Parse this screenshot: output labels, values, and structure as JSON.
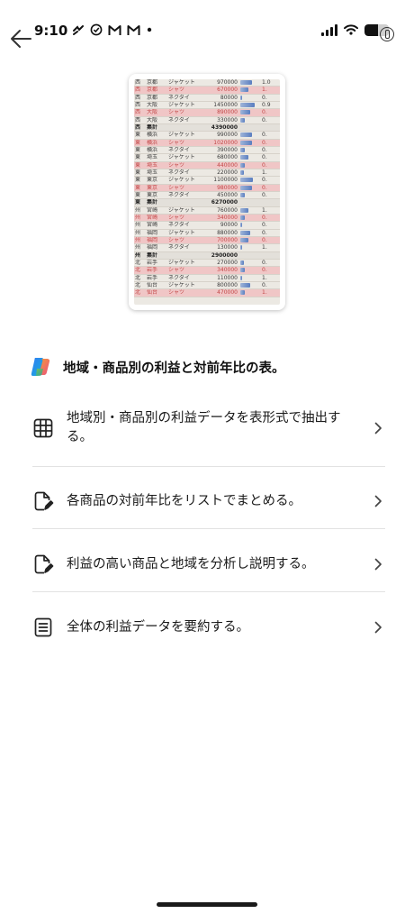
{
  "status": {
    "time": "9:10",
    "left_icons": [
      "missed-call-icon",
      "check-circle-icon",
      "gmail-icon",
      "gmail-icon",
      "dot-icon"
    ],
    "signal_bars": 4,
    "battery_level": 0.55
  },
  "thumbnail": {
    "rows": [
      {
        "c1": "西",
        "c2": "京都",
        "c3": "ジャケット",
        "c4": "970000",
        "bar": 0.7,
        "c6": "1.0",
        "style": "normal"
      },
      {
        "c1": "西",
        "c2": "京都",
        "c3": "シャツ",
        "c4": "670000",
        "bar": 0.5,
        "c6": "1.",
        "style": "pink"
      },
      {
        "c1": "西",
        "c2": "京都",
        "c3": "ネクタイ",
        "c4": "80000",
        "bar": 0.1,
        "c6": "0.",
        "style": "normal"
      },
      {
        "c1": "西",
        "c2": "大阪",
        "c3": "ジャケット",
        "c4": "1450000",
        "bar": 0.9,
        "c6": "0.9",
        "style": "normal"
      },
      {
        "c1": "西",
        "c2": "大阪",
        "c3": "シャツ",
        "c4": "890000",
        "bar": 0.6,
        "c6": "0.",
        "style": "pink"
      },
      {
        "c1": "西",
        "c2": "大阪",
        "c3": "ネクタイ",
        "c4": "330000",
        "bar": 0.3,
        "c6": "0.",
        "style": "normal"
      },
      {
        "c1": "西",
        "c2": "集計",
        "c3": "",
        "c4": "4390000",
        "bar": 0,
        "c6": "",
        "style": "total"
      },
      {
        "c1": "東",
        "c2": "横浜",
        "c3": "ジャケット",
        "c4": "990000",
        "bar": 0.7,
        "c6": "0.",
        "style": "normal"
      },
      {
        "c1": "東",
        "c2": "横浜",
        "c3": "シャツ",
        "c4": "1020000",
        "bar": 0.7,
        "c6": "0.",
        "style": "pink"
      },
      {
        "c1": "東",
        "c2": "横浜",
        "c3": "ネクタイ",
        "c4": "390000",
        "bar": 0.3,
        "c6": "0.",
        "style": "normal"
      },
      {
        "c1": "東",
        "c2": "埼玉",
        "c3": "ジャケット",
        "c4": "680000",
        "bar": 0.5,
        "c6": "0.",
        "style": "normal"
      },
      {
        "c1": "東",
        "c2": "埼玉",
        "c3": "シャツ",
        "c4": "440000",
        "bar": 0.3,
        "c6": "0.",
        "style": "pink"
      },
      {
        "c1": "東",
        "c2": "埼玉",
        "c3": "ネクタイ",
        "c4": "220000",
        "bar": 0.2,
        "c6": "1.",
        "style": "normal"
      },
      {
        "c1": "東",
        "c2": "東京",
        "c3": "ジャケット",
        "c4": "1100000",
        "bar": 0.8,
        "c6": "0.",
        "style": "normal"
      },
      {
        "c1": "東",
        "c2": "東京",
        "c3": "シャツ",
        "c4": "980000",
        "bar": 0.7,
        "c6": "0.",
        "style": "pink"
      },
      {
        "c1": "東",
        "c2": "東京",
        "c3": "ネクタイ",
        "c4": "450000",
        "bar": 0.3,
        "c6": "0.",
        "style": "normal"
      },
      {
        "c1": "東",
        "c2": "集計",
        "c3": "",
        "c4": "6270000",
        "bar": 0,
        "c6": "",
        "style": "total"
      },
      {
        "c1": "州",
        "c2": "宮崎",
        "c3": "ジャケット",
        "c4": "760000",
        "bar": 0.5,
        "c6": "1.",
        "style": "normal"
      },
      {
        "c1": "州",
        "c2": "宮崎",
        "c3": "シャツ",
        "c4": "340000",
        "bar": 0.3,
        "c6": "0.",
        "style": "pink"
      },
      {
        "c1": "州",
        "c2": "宮崎",
        "c3": "ネクタイ",
        "c4": "90000",
        "bar": 0.1,
        "c6": "0.",
        "style": "normal"
      },
      {
        "c1": "州",
        "c2": "福岡",
        "c3": "ジャケット",
        "c4": "880000",
        "bar": 0.6,
        "c6": "0.",
        "style": "normal"
      },
      {
        "c1": "州",
        "c2": "福岡",
        "c3": "シャツ",
        "c4": "700000",
        "bar": 0.5,
        "c6": "0.",
        "style": "pink"
      },
      {
        "c1": "州",
        "c2": "福岡",
        "c3": "ネクタイ",
        "c4": "130000",
        "bar": 0.1,
        "c6": "1.",
        "style": "normal"
      },
      {
        "c1": "州",
        "c2": "集計",
        "c3": "",
        "c4": "2900000",
        "bar": 0,
        "c6": "",
        "style": "total"
      },
      {
        "c1": "北",
        "c2": "岩手",
        "c3": "ジャケット",
        "c4": "270000",
        "bar": 0.2,
        "c6": "0.",
        "style": "normal"
      },
      {
        "c1": "北",
        "c2": "岩手",
        "c3": "シャツ",
        "c4": "340000",
        "bar": 0.3,
        "c6": "0.",
        "style": "pink"
      },
      {
        "c1": "北",
        "c2": "岩手",
        "c3": "ネクタイ",
        "c4": "110000",
        "bar": 0.1,
        "c6": "1.",
        "style": "normal"
      },
      {
        "c1": "北",
        "c2": "仙台",
        "c3": "ジャケット",
        "c4": "800000",
        "bar": 0.6,
        "c6": "0.",
        "style": "normal"
      },
      {
        "c1": "北",
        "c2": "仙台",
        "c3": "シャツ",
        "c4": "470000",
        "bar": 0.3,
        "c6": "1.",
        "style": "pink"
      }
    ]
  },
  "heading": {
    "icon": "copilot-logo-icon",
    "text": "地域・商品別の利益と対前年比の表。"
  },
  "suggestions": [
    {
      "icon": "table-grid-icon",
      "label": "地域別・商品別の利益データを表形式で抽出する。"
    },
    {
      "icon": "document-edit-icon",
      "label": "各商品の対前年比をリストでまとめる。"
    },
    {
      "icon": "document-edit-icon",
      "label": "利益の高い商品と地域を分析し説明する。"
    },
    {
      "icon": "document-lines-icon",
      "label": "全体の利益データを要約する。"
    }
  ],
  "colors": {
    "background": "#ffffff",
    "row_highlight": "#f0c6c6",
    "row_highlight_text": "#c24747",
    "divider": "#e2e2e2"
  }
}
